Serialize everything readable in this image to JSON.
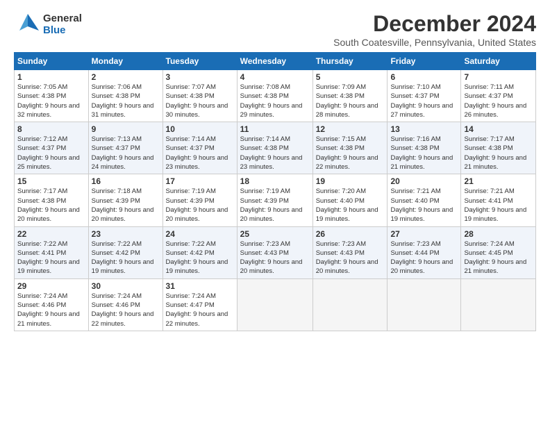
{
  "header": {
    "logo_general": "General",
    "logo_blue": "Blue",
    "month_title": "December 2024",
    "location": "South Coatesville, Pennsylvania, United States"
  },
  "days_of_week": [
    "Sunday",
    "Monday",
    "Tuesday",
    "Wednesday",
    "Thursday",
    "Friday",
    "Saturday"
  ],
  "weeks": [
    [
      {
        "day": "1",
        "sunrise": "7:05 AM",
        "sunset": "4:38 PM",
        "daylight": "9 hours and 32 minutes."
      },
      {
        "day": "2",
        "sunrise": "7:06 AM",
        "sunset": "4:38 PM",
        "daylight": "9 hours and 31 minutes."
      },
      {
        "day": "3",
        "sunrise": "7:07 AM",
        "sunset": "4:38 PM",
        "daylight": "9 hours and 30 minutes."
      },
      {
        "day": "4",
        "sunrise": "7:08 AM",
        "sunset": "4:38 PM",
        "daylight": "9 hours and 29 minutes."
      },
      {
        "day": "5",
        "sunrise": "7:09 AM",
        "sunset": "4:38 PM",
        "daylight": "9 hours and 28 minutes."
      },
      {
        "day": "6",
        "sunrise": "7:10 AM",
        "sunset": "4:37 PM",
        "daylight": "9 hours and 27 minutes."
      },
      {
        "day": "7",
        "sunrise": "7:11 AM",
        "sunset": "4:37 PM",
        "daylight": "9 hours and 26 minutes."
      }
    ],
    [
      {
        "day": "8",
        "sunrise": "7:12 AM",
        "sunset": "4:37 PM",
        "daylight": "9 hours and 25 minutes."
      },
      {
        "day": "9",
        "sunrise": "7:13 AM",
        "sunset": "4:37 PM",
        "daylight": "9 hours and 24 minutes."
      },
      {
        "day": "10",
        "sunrise": "7:14 AM",
        "sunset": "4:37 PM",
        "daylight": "9 hours and 23 minutes."
      },
      {
        "day": "11",
        "sunrise": "7:14 AM",
        "sunset": "4:38 PM",
        "daylight": "9 hours and 23 minutes."
      },
      {
        "day": "12",
        "sunrise": "7:15 AM",
        "sunset": "4:38 PM",
        "daylight": "9 hours and 22 minutes."
      },
      {
        "day": "13",
        "sunrise": "7:16 AM",
        "sunset": "4:38 PM",
        "daylight": "9 hours and 21 minutes."
      },
      {
        "day": "14",
        "sunrise": "7:17 AM",
        "sunset": "4:38 PM",
        "daylight": "9 hours and 21 minutes."
      }
    ],
    [
      {
        "day": "15",
        "sunrise": "7:17 AM",
        "sunset": "4:38 PM",
        "daylight": "9 hours and 20 minutes."
      },
      {
        "day": "16",
        "sunrise": "7:18 AM",
        "sunset": "4:39 PM",
        "daylight": "9 hours and 20 minutes."
      },
      {
        "day": "17",
        "sunrise": "7:19 AM",
        "sunset": "4:39 PM",
        "daylight": "9 hours and 20 minutes."
      },
      {
        "day": "18",
        "sunrise": "7:19 AM",
        "sunset": "4:39 PM",
        "daylight": "9 hours and 20 minutes."
      },
      {
        "day": "19",
        "sunrise": "7:20 AM",
        "sunset": "4:40 PM",
        "daylight": "9 hours and 19 minutes."
      },
      {
        "day": "20",
        "sunrise": "7:21 AM",
        "sunset": "4:40 PM",
        "daylight": "9 hours and 19 minutes."
      },
      {
        "day": "21",
        "sunrise": "7:21 AM",
        "sunset": "4:41 PM",
        "daylight": "9 hours and 19 minutes."
      }
    ],
    [
      {
        "day": "22",
        "sunrise": "7:22 AM",
        "sunset": "4:41 PM",
        "daylight": "9 hours and 19 minutes."
      },
      {
        "day": "23",
        "sunrise": "7:22 AM",
        "sunset": "4:42 PM",
        "daylight": "9 hours and 19 minutes."
      },
      {
        "day": "24",
        "sunrise": "7:22 AM",
        "sunset": "4:42 PM",
        "daylight": "9 hours and 19 minutes."
      },
      {
        "day": "25",
        "sunrise": "7:23 AM",
        "sunset": "4:43 PM",
        "daylight": "9 hours and 20 minutes."
      },
      {
        "day": "26",
        "sunrise": "7:23 AM",
        "sunset": "4:43 PM",
        "daylight": "9 hours and 20 minutes."
      },
      {
        "day": "27",
        "sunrise": "7:23 AM",
        "sunset": "4:44 PM",
        "daylight": "9 hours and 20 minutes."
      },
      {
        "day": "28",
        "sunrise": "7:24 AM",
        "sunset": "4:45 PM",
        "daylight": "9 hours and 21 minutes."
      }
    ],
    [
      {
        "day": "29",
        "sunrise": "7:24 AM",
        "sunset": "4:46 PM",
        "daylight": "9 hours and 21 minutes."
      },
      {
        "day": "30",
        "sunrise": "7:24 AM",
        "sunset": "4:46 PM",
        "daylight": "9 hours and 22 minutes."
      },
      {
        "day": "31",
        "sunrise": "7:24 AM",
        "sunset": "4:47 PM",
        "daylight": "9 hours and 22 minutes."
      },
      null,
      null,
      null,
      null
    ]
  ],
  "labels": {
    "sunrise": "Sunrise:",
    "sunset": "Sunset:",
    "daylight": "Daylight:"
  }
}
